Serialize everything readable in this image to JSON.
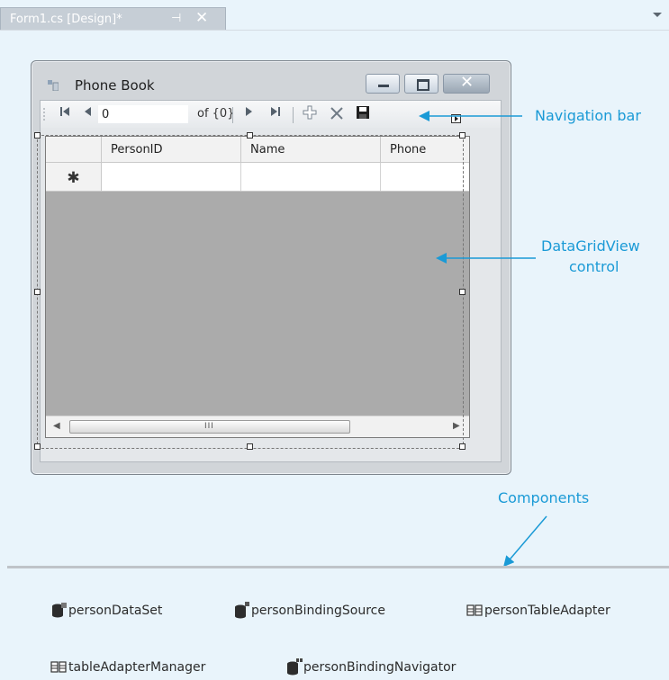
{
  "tab": {
    "title": "Form1.cs [Design]*",
    "pin": "⊣",
    "close": "✕"
  },
  "form": {
    "title": "Phone Book",
    "navigator": {
      "position": "0",
      "count": "of {0}"
    },
    "grid": {
      "columns": [
        "PersonID",
        "Name",
        "Phone"
      ],
      "new_row_marker": "✱",
      "scroll_grip": "III"
    }
  },
  "callouts": {
    "navigation_bar": "Navigation bar",
    "datagridview_line1": "DataGridView",
    "datagridview_line2": "control",
    "components": "Components"
  },
  "components": [
    {
      "name": "personDataSet",
      "icon": "dataset-icon"
    },
    {
      "name": "personBindingSource",
      "icon": "binding-source-icon"
    },
    {
      "name": "personTableAdapter",
      "icon": "table-adapter-icon"
    },
    {
      "name": "tableAdapterManager",
      "icon": "table-adapter-manager-icon"
    },
    {
      "name": "personBindingNavigator",
      "icon": "binding-navigator-icon"
    }
  ],
  "colors": {
    "accent": "#1a9ad6",
    "designer_bg": "#e9f4fb",
    "grid_bg": "#ababab"
  }
}
